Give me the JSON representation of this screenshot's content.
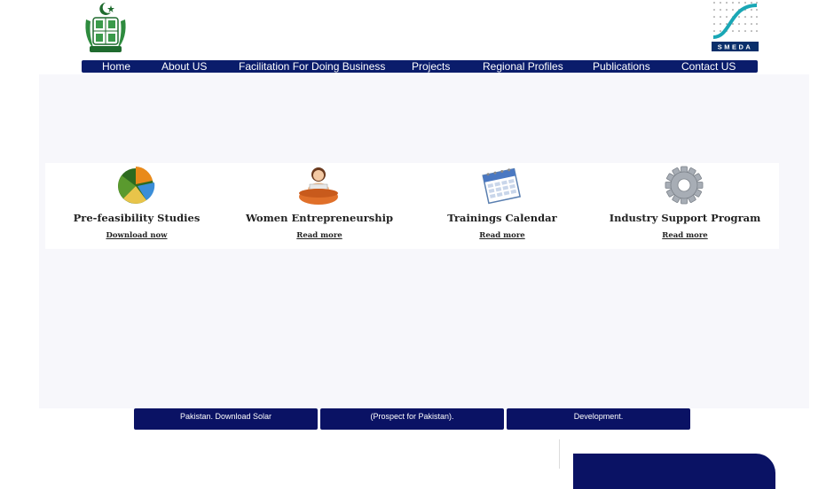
{
  "header": {
    "smeda_logo_text": "SMEDA"
  },
  "nav": {
    "items": [
      {
        "label": "Home"
      },
      {
        "label": "About US"
      },
      {
        "label": "Facilitation For Doing Business"
      },
      {
        "label": "Projects"
      },
      {
        "label": "Regional Profiles"
      },
      {
        "label": "Publications"
      },
      {
        "label": "Contact US"
      }
    ]
  },
  "cards": [
    {
      "title": "Pre-feasibility Studies",
      "link": "Download now",
      "icon": "pie-chart-icon"
    },
    {
      "title": "Women Entrepreneurship",
      "link": "Read more",
      "icon": "woman-worker-icon"
    },
    {
      "title": "Trainings Calendar",
      "link": "Read more",
      "icon": "calendar-icon"
    },
    {
      "title": "Industry Support Program",
      "link": "Read more",
      "icon": "gear-icon"
    }
  ],
  "banners": [
    {
      "text": "Pakistan. Download Solar"
    },
    {
      "text": "(Prospect for Pakistan)."
    },
    {
      "text": "Development."
    }
  ],
  "colors": {
    "nav_bg": "#0a1c6b",
    "banner_bg": "#0a1264",
    "smeda_teal": "#1aa7b5",
    "emblem_green": "#1f6b2e"
  }
}
